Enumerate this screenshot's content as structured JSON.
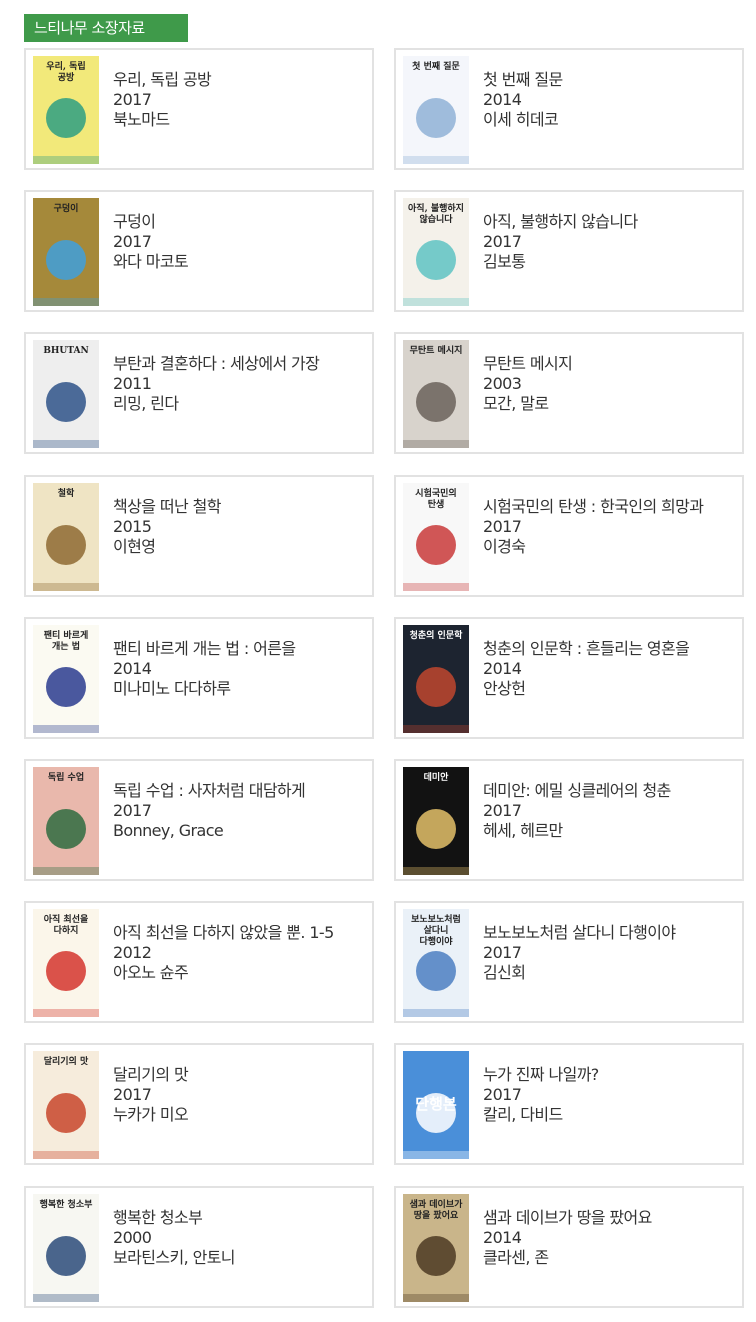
{
  "section": {
    "title": "느티나무 소장자료"
  },
  "books": [
    {
      "title": "우리, 독립 공방",
      "year": "2017",
      "author": "북노마드",
      "cover_text": "우리, 독립 공방",
      "cover_color": "#f2e97a",
      "cover_accent": "#2e9f83",
      "cover_icon": "craft-tools-icon"
    },
    {
      "title": "첫 번째 질문",
      "year": "2014",
      "author": "이세 히데코",
      "cover_text": "첫 번째 질문",
      "cover_color": "#f4f6fb",
      "cover_accent": "#8fb2d6",
      "cover_icon": "girl-on-globe-icon"
    },
    {
      "title": "구덩이",
      "year": "2017",
      "author": "와다 마코토",
      "cover_text": "구덩이",
      "cover_color": "#a5893a",
      "cover_accent": "#3ea0dd",
      "cover_icon": "blue-hole-icon"
    },
    {
      "title": "아직, 불행하지 않습니다",
      "year": "2017",
      "author": "김보통",
      "cover_text": "아직, 불행하지 않습니다",
      "cover_color": "#f4f1ea",
      "cover_accent": "#5ec3c3",
      "cover_icon": "necktie-icon"
    },
    {
      "title": "부탄과 결혼하다 : 세상에서 가장",
      "year": "2011",
      "author": "리밍, 린다",
      "cover_text": "BHUTAN",
      "cover_color": "#eeeeee",
      "cover_accent": "#2e5288",
      "cover_icon": "mountain-icon"
    },
    {
      "title": "무탄트 메시지",
      "year": "2003",
      "author": "모간, 말로",
      "cover_text": "무탄트 메시지",
      "cover_color": "#d8d3cc",
      "cover_accent": "#6b625a",
      "cover_icon": "portrait-icon"
    },
    {
      "title": "책상을 떠난 철학",
      "year": "2015",
      "author": "이현영",
      "cover_text": "철학",
      "cover_color": "#efe4c4",
      "cover_accent": "#8e6a33",
      "cover_icon": "desk-icon"
    },
    {
      "title": "시험국민의 탄생 : 한국인의 희망과",
      "year": "2017",
      "author": "이경숙",
      "cover_text": "시험국민의 탄생",
      "cover_color": "#f8f8f8",
      "cover_accent": "#c93a3a",
      "cover_icon": "desk-chair-icon"
    },
    {
      "title": "팬티 바르게 개는 법 : 어른을",
      "year": "2014",
      "author": "미나미노 다다하루",
      "cover_text": "팬티 바르게 개는 법",
      "cover_color": "#fbfaf2",
      "cover_accent": "#2a3b8f",
      "cover_icon": "cartoon-figures-icon"
    },
    {
      "title": "청춘의 인문학 : 흔들리는 영혼을",
      "year": "2014",
      "author": "안상헌",
      "cover_text": "청춘의 인문학",
      "cover_color": "#1d2430",
      "cover_accent": "#c0462e",
      "cover_icon": "crowd-icon"
    },
    {
      "title": "독립 수업 : 사자처럼 대담하게",
      "year": "2017",
      "author": "Bonney, Grace",
      "cover_text": "독립 수업",
      "cover_color": "#e9b8ac",
      "cover_accent": "#2f6b3f",
      "cover_icon": "emblem-icon"
    },
    {
      "title": "데미안: 에밀 싱클레어의 청춘",
      "year": "2017",
      "author": "헤세, 헤르만",
      "cover_text": "데미안",
      "cover_color": "#121212",
      "cover_accent": "#e4c16a",
      "cover_icon": "sunrise-figure-icon"
    },
    {
      "title": "아직 최선을 다하지 않았을 뿐. 1-5",
      "year": "2012",
      "author": "아오노 슌주",
      "cover_text": "아직 최선을 다하지",
      "cover_color": "#fbf6ea",
      "cover_accent": "#d3352e",
      "cover_icon": "manga-character-icon"
    },
    {
      "title": "보노보노처럼 살다니 다행이야",
      "year": "2017",
      "author": "김신회",
      "cover_text": "보노보노처럼 살다니 다행이야",
      "cover_color": "#eaf1f8",
      "cover_accent": "#4c7fc2",
      "cover_icon": "bonobono-icon"
    },
    {
      "title": "달리기의 맛",
      "year": "2017",
      "author": "누카가 미오",
      "cover_text": "달리기의 맛",
      "cover_color": "#f6ecdc",
      "cover_accent": "#c8462c",
      "cover_icon": "runners-icon"
    },
    {
      "title": "누가 진짜 나일까?",
      "year": "2017",
      "author": "칼리, 다비드",
      "cover_text": "단행본",
      "cover_color": "#4a8fd9",
      "cover_accent": "#ffffff",
      "cover_icon": "placeholder-cover-icon"
    },
    {
      "title": "행복한 청소부",
      "year": "2000",
      "author": "보라틴스키, 안토니",
      "cover_text": "행복한 청소부",
      "cover_color": "#f7f7f2",
      "cover_accent": "#2c4b7a",
      "cover_icon": "cleaner-portrait-icon"
    },
    {
      "title": "샘과 데이브가 땅을 팠어요",
      "year": "2014",
      "author": "클라센, 존",
      "cover_text": "샘과 데이브가 땅을 팠어요",
      "cover_color": "#c9b58a",
      "cover_accent": "#4c3a22",
      "cover_icon": "digging-boys-icon"
    }
  ]
}
